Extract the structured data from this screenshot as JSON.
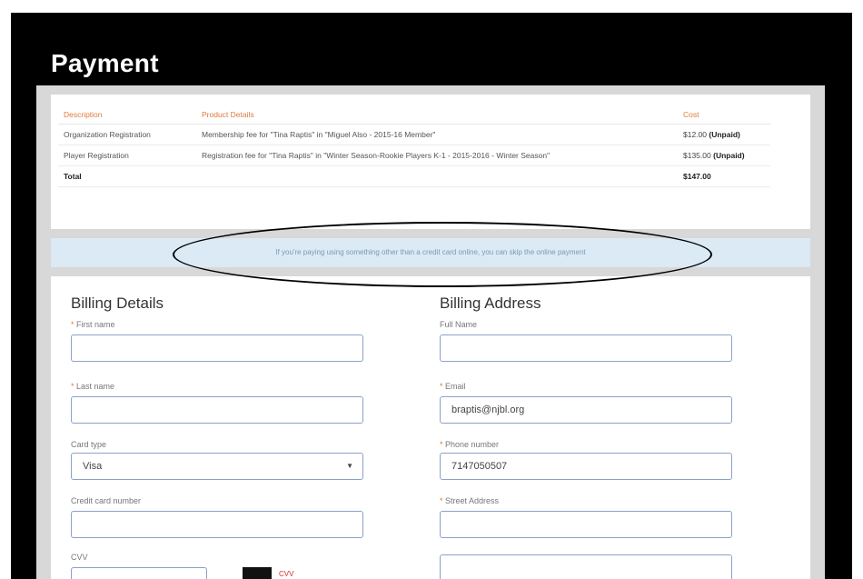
{
  "page": {
    "title": "Payment"
  },
  "summary": {
    "headers": {
      "description": "Description",
      "product_details": "Product Details",
      "cost": "Cost"
    },
    "rows": [
      {
        "description": "Organization Registration",
        "details": "Membership fee for \"Tina Raptis\" in \"Miguel Also - 2015-16 Member\"",
        "amount": "$12.00",
        "status": "(Unpaid)"
      },
      {
        "description": "Player Registration",
        "details": "Registration fee for \"Tina Raptis\" in \"Winter Season-Rookie Players K-1 - 2015-2016 - Winter Season\"",
        "amount": "$135.00",
        "status": "(Unpaid)"
      }
    ],
    "total_label": "Total",
    "total_value": "$147.00"
  },
  "notice": "If you're paying using something other than a credit card online, you can skip the online payment",
  "billing_details": {
    "title": "Billing Details",
    "first_name_label": "First name",
    "first_name_value": "",
    "last_name_label": "Last name",
    "last_name_value": "",
    "card_type_label": "Card type",
    "card_type_value": "Visa",
    "card_number_label": "Credit card number",
    "card_number_value": "",
    "cvv_label": "CVV",
    "cvv_value": "",
    "cvv_hint": "CVV"
  },
  "billing_address": {
    "title": "Billing Address",
    "full_name_label": "Full Name",
    "full_name_value": "",
    "email_label": "Email",
    "email_value": "braptis@njbl.org",
    "phone_label": "Phone number",
    "phone_value": "7147050507",
    "street_label": "Street Address",
    "street_value": "",
    "street2_value": ""
  }
}
